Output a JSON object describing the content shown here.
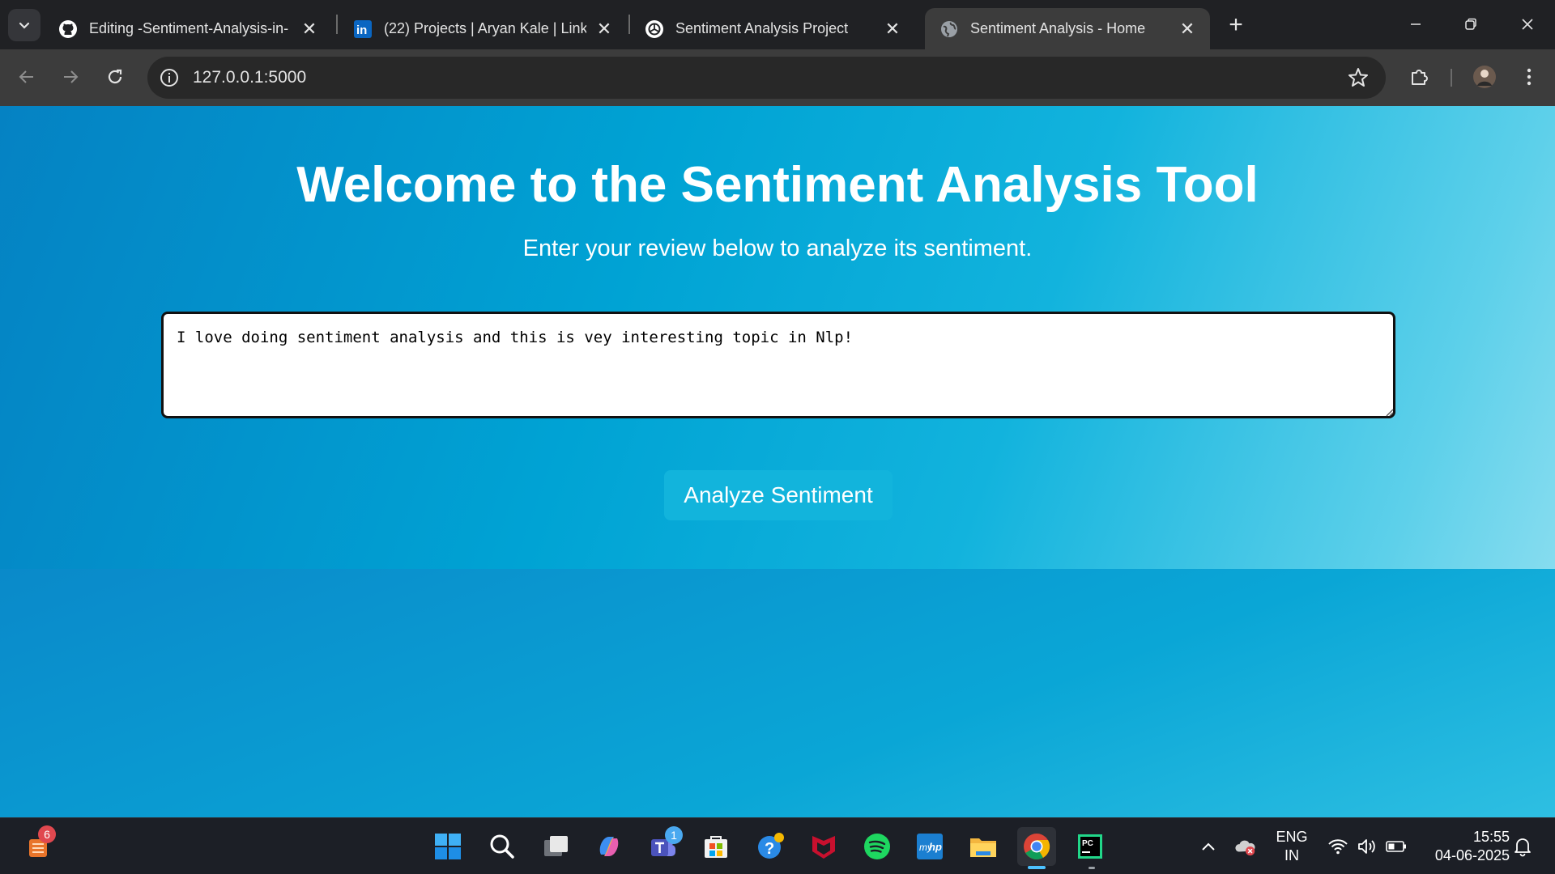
{
  "browser": {
    "tabs": [
      {
        "title": "Editing -Sentiment-Analysis-in-",
        "icon": "github-icon"
      },
      {
        "title": "(22) Projects | Aryan Kale | Linke",
        "icon": "linkedin-icon"
      },
      {
        "title": "Sentiment Analysis Project",
        "icon": "chatgpt-icon"
      },
      {
        "title": "Sentiment Analysis - Home",
        "icon": "globe-icon",
        "active": true
      }
    ],
    "url": "127.0.0.1:5000"
  },
  "page": {
    "heading": "Welcome to the Sentiment Analysis Tool",
    "subtitle": "Enter your review below to analyze its sentiment.",
    "review_text": "I love doing sentiment analysis and this is vey interesting topic in Nlp!",
    "analyze_button": "Analyze Sentiment"
  },
  "taskbar": {
    "widgets_badge": "6",
    "teams_badge": "1",
    "language_line1": "ENG",
    "language_line2": "IN",
    "time": "15:55",
    "date": "04-06-2025"
  },
  "colors": {
    "accent_button": "#12b4dc",
    "chrome_dark": "#202124",
    "chrome_toolbar": "#3c3c3c"
  }
}
